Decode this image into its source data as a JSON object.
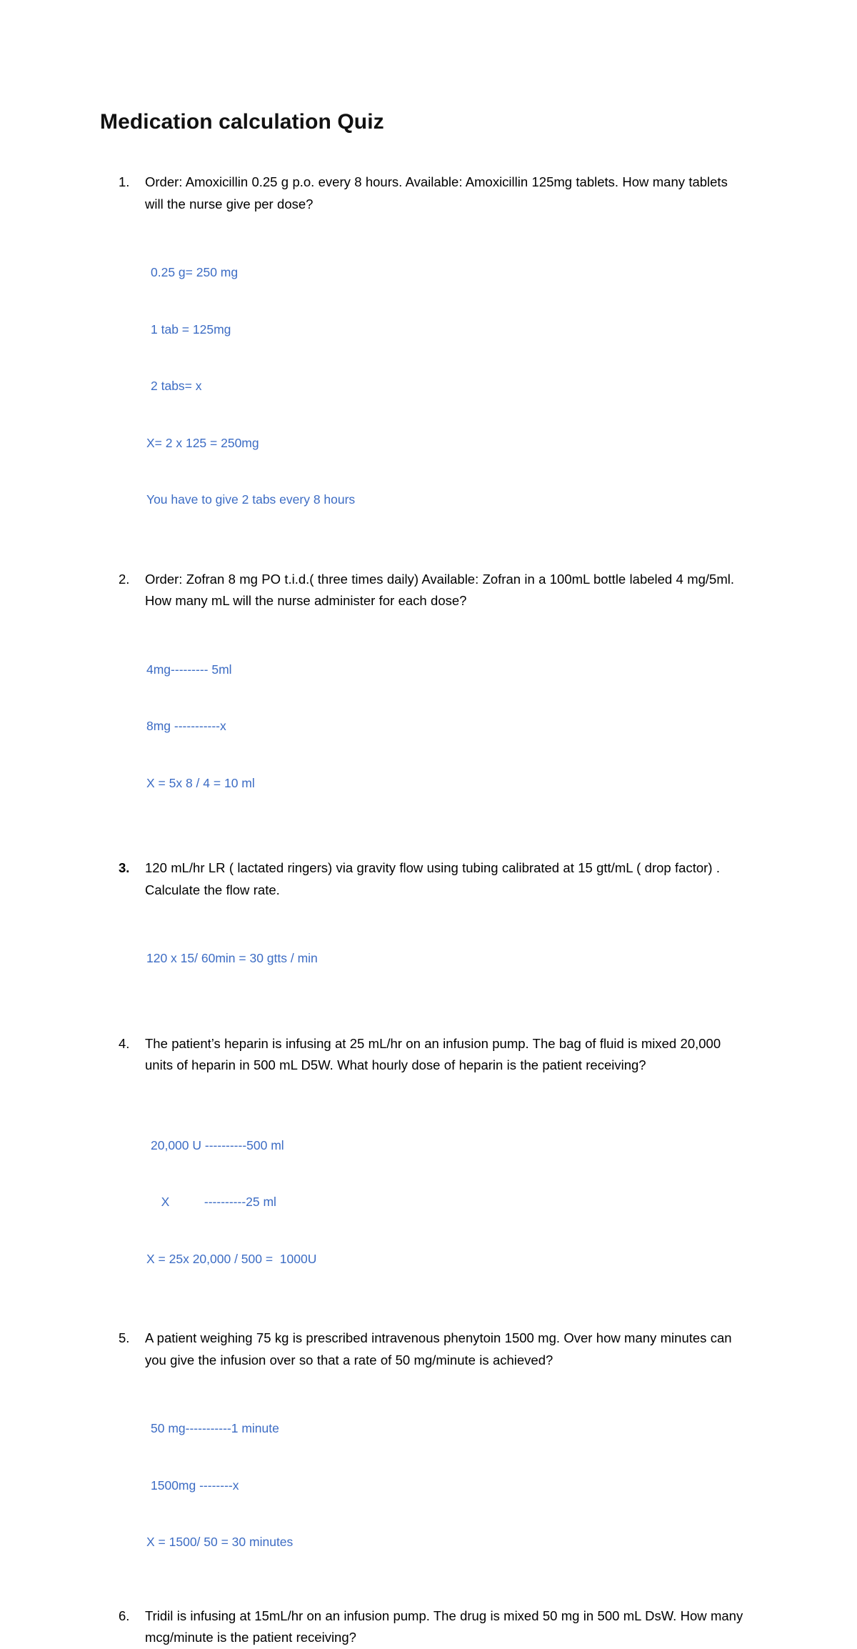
{
  "document": {
    "title": "Medication calculation Quiz",
    "answer_color": "#3C6CC4",
    "text_color": "#000000",
    "background": "#ffffff"
  },
  "questions": [
    {
      "number": "1.",
      "bold_number": false,
      "text": "Order: Amoxicillin 0.25 g p.o. every 8 hours. Available: Amoxicillin 125mg tablets. How many tablets will the nurse give per dose?",
      "answer_lines": [
        "0.25 g= 250 mg",
        "1 tab = 125mg",
        "2 tabs= x",
        "X= 2 x 125 = 250mg",
        "You have to give 2 tabs every 8 hours"
      ]
    },
    {
      "number": "2.",
      "bold_number": false,
      "text": "Order: Zofran 8 mg PO t.i.d.( three times daily)  Available: Zofran in a 100mL bottle labeled 4 mg/5ml. How many mL will the nurse administer for each dose?",
      "answer_lines": [
        "4mg--------- 5ml",
        "8mg -----------x",
        "X = 5x 8 / 4 = 10 ml"
      ]
    },
    {
      "number": "3.",
      "bold_number": true,
      "text": " 120 mL/hr LR ( lactated ringers)  via gravity flow using tubing calibrated at 15 gtt/mL ( drop factor) . Calculate the flow rate.",
      "answer_lines": [
        "120 x 15/ 60min = 30 gtts / min"
      ]
    },
    {
      "number": "4.",
      "bold_number": false,
      "text": "The patient’s heparin is infusing at 25 mL/hr on an infusion pump. The bag of fluid is mixed 20,000 units of heparin in 500 mL D5W. What hourly dose of heparin is the patient receiving?",
      "answer_lines": [
        "20,000 U ----------500 ml",
        "   X          ----------25 ml",
        "X = 25x 20,000 / 500 =  1000U"
      ]
    },
    {
      "number": "5.",
      "bold_number": false,
      "text": "A patient weighing 75 kg is prescribed intravenous phenytoin 1500 mg. Over how many minutes can you give the infusion over so that a rate of 50 mg/minute is achieved?",
      "answer_lines": [
        "50 mg-----------1 minute",
        "1500mg --------x",
        "X = 1500/ 50 = 30 minutes"
      ]
    },
    {
      "number": "6.",
      "bold_number": false,
      "text": "Tridil is infusing at 15mL/hr on an infusion pump. The drug is mixed 50 mg in 500 mL DsW. How many mcg/minute is the patient receiving?",
      "answer_lines": []
    }
  ]
}
